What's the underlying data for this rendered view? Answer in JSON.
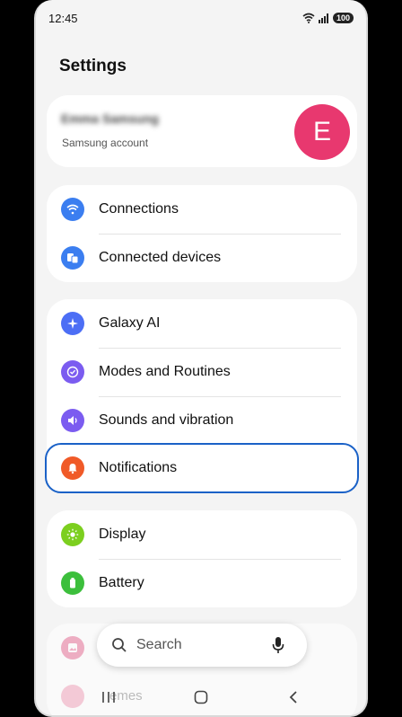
{
  "status": {
    "time": "12:45",
    "battery": "100"
  },
  "page": {
    "title": "Settings"
  },
  "account": {
    "name": "Emma Samsung",
    "subtitle": "Samsung account",
    "avatar_letter": "E"
  },
  "groups": [
    {
      "items": [
        {
          "label": "Connections",
          "icon": "wifi-icon",
          "color": "#3b7ef0"
        },
        {
          "label": "Connected devices",
          "icon": "devices-icon",
          "color": "#3b7ef0"
        }
      ]
    },
    {
      "items": [
        {
          "label": "Galaxy AI",
          "icon": "sparkle-icon",
          "color": "#4c6ef5"
        },
        {
          "label": "Modes and Routines",
          "icon": "check-circle-icon",
          "color": "#7b5cf0"
        },
        {
          "label": "Sounds and vibration",
          "icon": "speaker-icon",
          "color": "#7b5cf0"
        },
        {
          "label": "Notifications",
          "icon": "bell-icon",
          "color": "#f05a28"
        }
      ]
    },
    {
      "items": [
        {
          "label": "Display",
          "icon": "sun-icon",
          "color": "#7ccf1f"
        },
        {
          "label": "Battery",
          "icon": "battery-icon",
          "color": "#3cbf3c"
        }
      ]
    }
  ],
  "search": {
    "label": "Search"
  },
  "nav": {
    "partial_label": "emes"
  },
  "colors": {
    "highlight": "#1a61c7",
    "avatar": "#e8386f"
  }
}
